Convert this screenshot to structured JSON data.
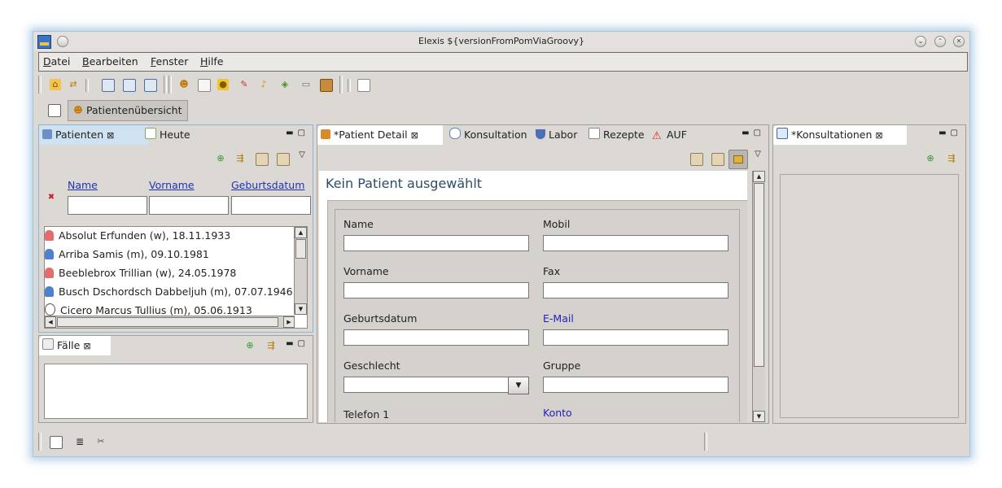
{
  "window": {
    "title": "Elexis ${versionFromPomViaGroovy}"
  },
  "menu": {
    "items": [
      {
        "key": "D",
        "rest": "atei"
      },
      {
        "key": "B",
        "rest": "earbeiten"
      },
      {
        "key": "F",
        "rest": "enster"
      },
      {
        "key": "H",
        "rest": "ilfe"
      }
    ]
  },
  "perspective": {
    "label": "Patientenübersicht"
  },
  "patients_view": {
    "tabs": [
      "Patienten",
      "Heute"
    ],
    "headers": [
      "Name",
      "Vorname",
      "Geburtsdatum"
    ],
    "filter_values": [
      "",
      "",
      ""
    ],
    "rows": [
      {
        "text": "Absolut Erfunden (w), 18.11.1933",
        "sex": "w"
      },
      {
        "text": "Arriba Samis (m), 09.10.1981",
        "sex": "m"
      },
      {
        "text": "Beeblebrox Trillian (w), 24.05.1978",
        "sex": "w"
      },
      {
        "text": "Busch Dschordsch Dabbeljuh (m), 07.07.1946",
        "sex": "m"
      },
      {
        "text": "Cicero Marcus Tullius (m), 05.06.1913",
        "sex": "deceased"
      }
    ]
  },
  "faelle_view": {
    "tab": "Fälle"
  },
  "center_view": {
    "tabs": [
      "*Patient Detail",
      "Konsultation",
      "Labor",
      "Rezepte",
      "AUF"
    ],
    "heading": "Kein Patient ausgewählt",
    "fields_left": [
      "Name",
      "Vorname",
      "Geburtsdatum",
      "Geschlecht",
      "Telefon 1"
    ],
    "fields_right": [
      "Mobil",
      "Fax",
      "E-Mail",
      "Gruppe",
      "Konto"
    ]
  },
  "right_view": {
    "tab": "*Konsultationen"
  },
  "colors": {
    "accent": "#8eb3d4",
    "link": "#2222bb",
    "heading": "#2c4d68"
  },
  "icons": [
    "home-icon",
    "sync-icon",
    "window-icons",
    "patient-icon",
    "pill-icon",
    "bell-icon",
    "add-icon",
    "filter-icon",
    "paste-icon",
    "lock-icon"
  ]
}
